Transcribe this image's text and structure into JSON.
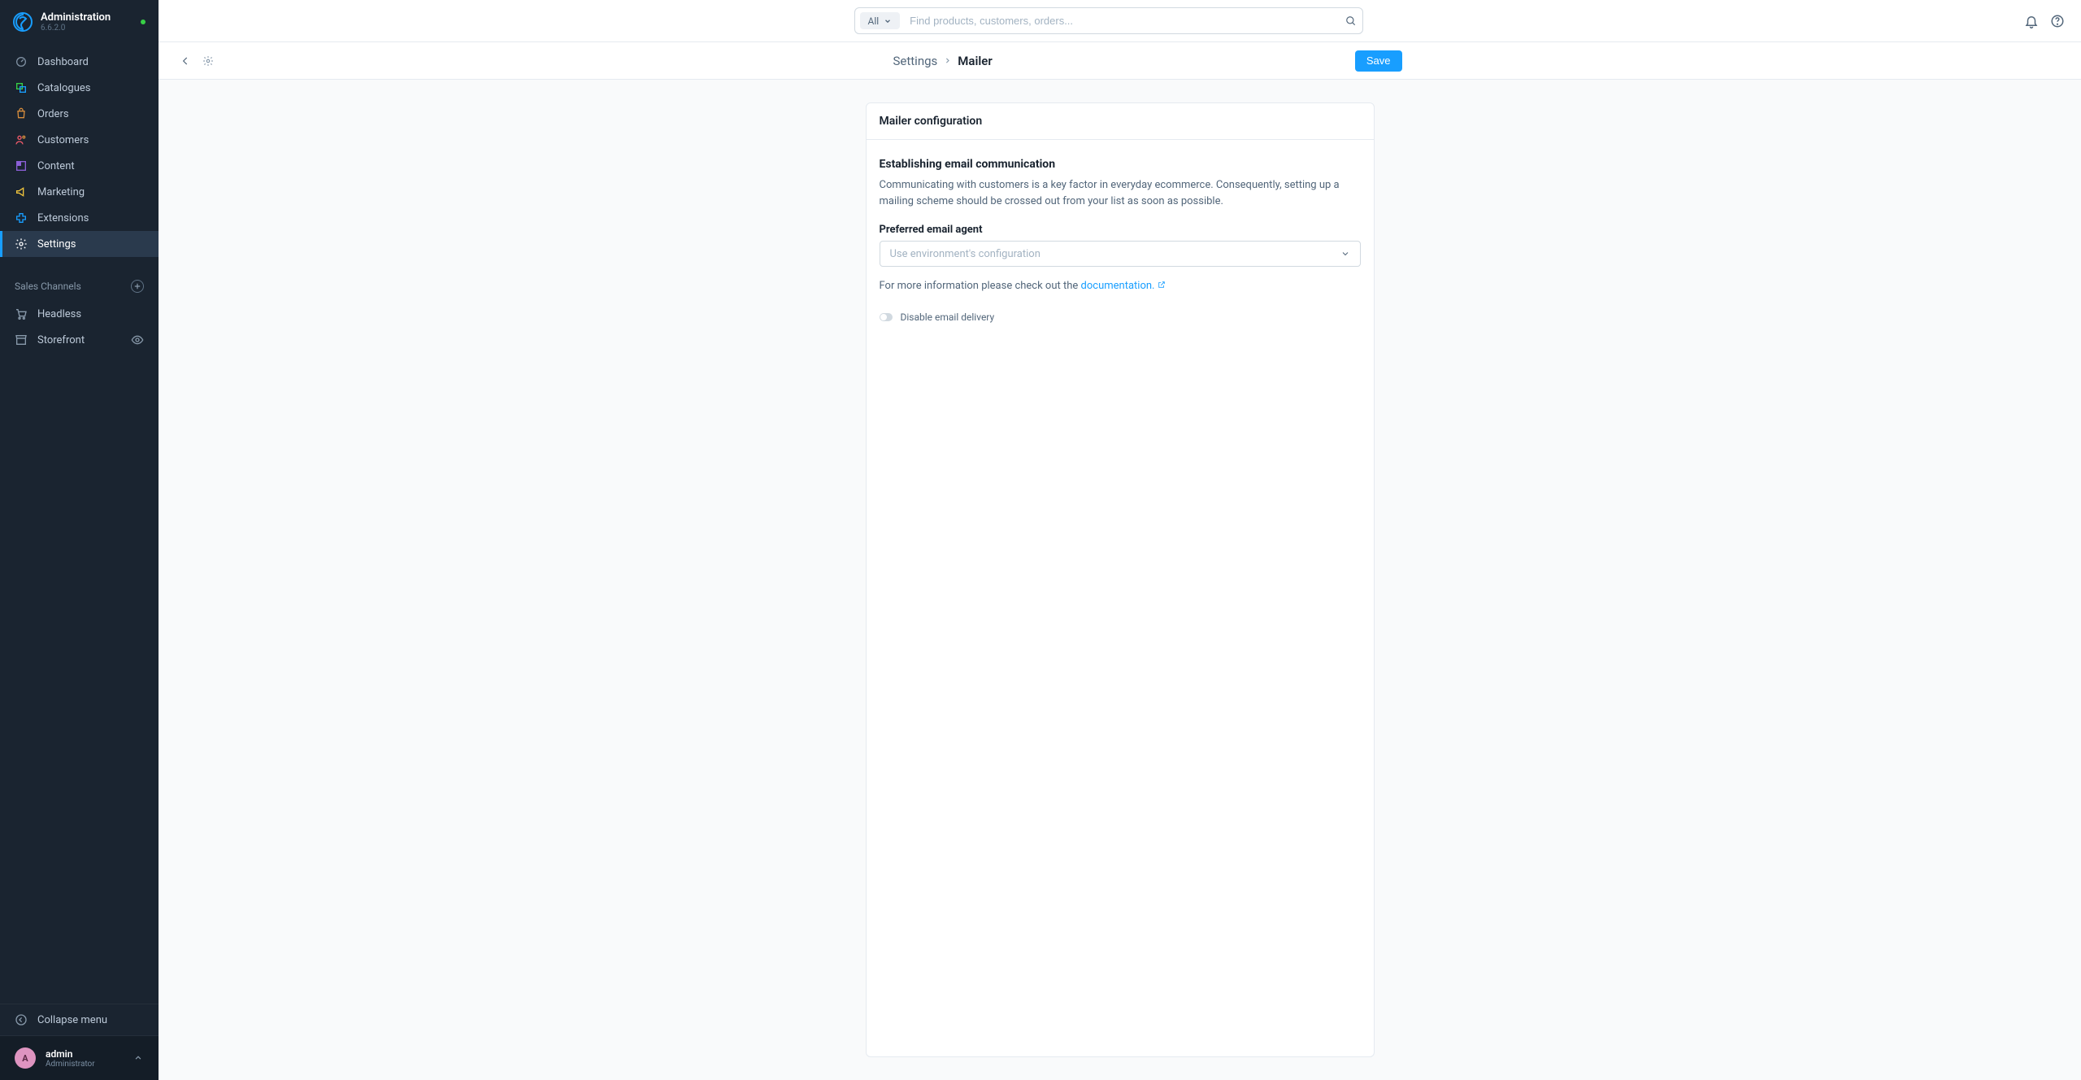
{
  "brand": {
    "title": "Administration",
    "version": "6.6.2.0"
  },
  "nav": [
    {
      "label": "Dashboard"
    },
    {
      "label": "Catalogues"
    },
    {
      "label": "Orders"
    },
    {
      "label": "Customers"
    },
    {
      "label": "Content"
    },
    {
      "label": "Marketing"
    },
    {
      "label": "Extensions"
    },
    {
      "label": "Settings"
    }
  ],
  "sales_channels": {
    "header": "Sales Channels",
    "items": [
      {
        "label": "Headless"
      },
      {
        "label": "Storefront"
      }
    ]
  },
  "collapse_label": "Collapse menu",
  "user": {
    "initial": "A",
    "name": "admin",
    "role": "Administrator"
  },
  "search": {
    "filter_label": "All",
    "placeholder": "Find products, customers, orders..."
  },
  "breadcrumb": {
    "parent": "Settings",
    "current": "Mailer"
  },
  "save_label": "Save",
  "card": {
    "title": "Mailer configuration",
    "section_title": "Establishing email communication",
    "section_desc": "Communicating with customers is a key factor in everyday ecommerce. Consequently, setting up a mailing scheme should be crossed out from your list as soon as possible.",
    "field_label": "Preferred email agent",
    "select_placeholder": "Use environment's configuration",
    "info_prefix": "For more information please check out the ",
    "doc_link_text": "documentation.",
    "toggle_label": "Disable email delivery"
  }
}
